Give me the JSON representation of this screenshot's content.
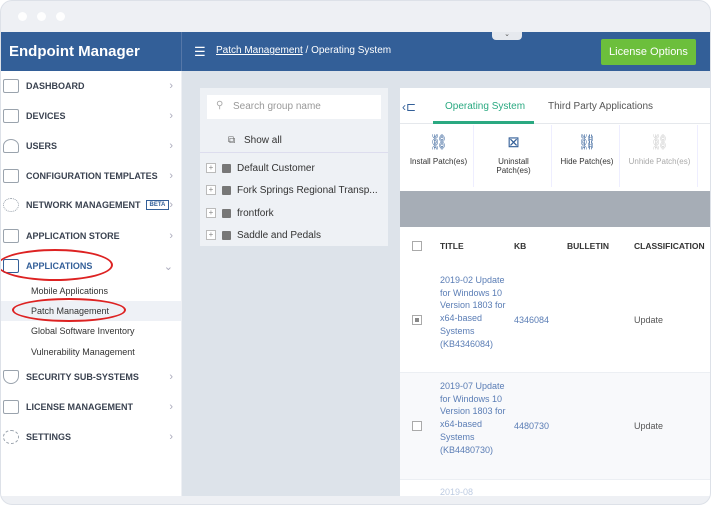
{
  "app": {
    "title": "Endpoint Manager",
    "license_button": "License Options"
  },
  "breadcrumb": {
    "parent": "Patch Management",
    "separator": "/",
    "current": "Operating System"
  },
  "sidebar": {
    "items": [
      {
        "label": "DASHBOARD"
      },
      {
        "label": "DEVICES"
      },
      {
        "label": "USERS"
      },
      {
        "label": "CONFIGURATION TEMPLATES"
      },
      {
        "label": "NETWORK MANAGEMENT",
        "badge": "BETA"
      },
      {
        "label": "APPLICATION STORE"
      },
      {
        "label": "APPLICATIONS"
      },
      {
        "label": "SECURITY SUB-SYSTEMS"
      },
      {
        "label": "LICENSE MANAGEMENT"
      },
      {
        "label": "SETTINGS"
      }
    ],
    "sub_items": [
      {
        "label": "Mobile Applications"
      },
      {
        "label": "Patch Management"
      },
      {
        "label": "Global Software Inventory"
      },
      {
        "label": "Vulnerability Management"
      }
    ]
  },
  "groups": {
    "search_placeholder": "Search group name",
    "show_all": "Show all",
    "items": [
      {
        "label": "Default Customer"
      },
      {
        "label": "Fork Springs Regional Transp..."
      },
      {
        "label": "frontfork"
      },
      {
        "label": "Saddle and Pedals"
      }
    ]
  },
  "tabs": [
    {
      "label": "Operating System"
    },
    {
      "label": "Third Party Applications"
    }
  ],
  "toolbar": [
    {
      "label": "Install Patch(es)"
    },
    {
      "label": "Uninstall Patch(es)"
    },
    {
      "label": "Hide Patch(es)"
    },
    {
      "label": "Unhide Patch(es)"
    }
  ],
  "table": {
    "columns": [
      "TITLE",
      "KB",
      "BULLETIN",
      "CLASSIFICATION"
    ],
    "rows": [
      {
        "title": "2019-02 Update for Windows 10 Version 1803 for x64-based Systems (KB4346084)",
        "kb": "4346084",
        "bulletin": "",
        "classification": "Update"
      },
      {
        "title": "2019-07 Update for Windows 10 Version 1803 for x64-based Systems (KB4480730)",
        "kb": "4480730",
        "bulletin": "",
        "classification": "Update"
      },
      {
        "title": "2019-08",
        "kb": "",
        "bulletin": "",
        "classification": ""
      }
    ]
  }
}
